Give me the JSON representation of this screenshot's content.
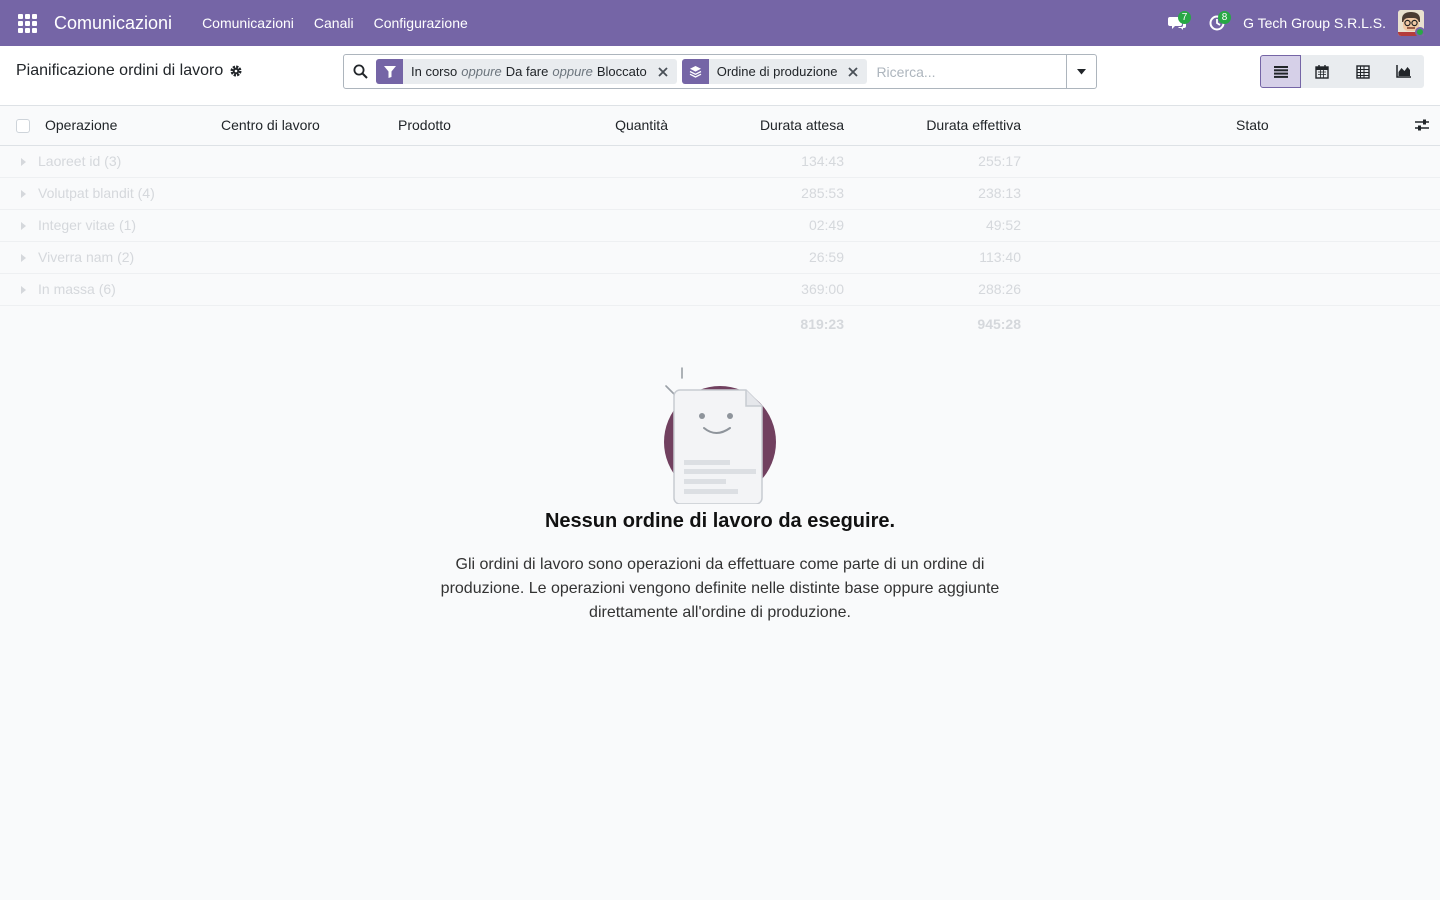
{
  "navbar": {
    "app_name": "Comunicazioni",
    "menu": [
      "Comunicazioni",
      "Canali",
      "Configurazione"
    ],
    "messages_count": "7",
    "activities_count": "8",
    "company": "G Tech Group S.R.L.S.",
    "accent": "#7565a6"
  },
  "control": {
    "title": "Pianificazione ordini di lavoro",
    "filter_facet": {
      "values": [
        "In corso",
        "Da fare",
        "Bloccato"
      ],
      "separator": "oppure"
    },
    "groupby_facet": {
      "value": "Ordine di produzione"
    },
    "search_placeholder": "Ricerca...",
    "views": [
      "list-icon",
      "calendar-icon",
      "pivot-icon",
      "graph-icon"
    ]
  },
  "list": {
    "columns": [
      "Operazione",
      "Centro di lavoro",
      "Prodotto",
      "Quantità",
      "Durata attesa",
      "Durata effettiva",
      "Stato"
    ],
    "groups": [
      {
        "name": "Laoreet id (3)",
        "expected": "134:43",
        "actual": "255:17"
      },
      {
        "name": "Volutpat blandit (4)",
        "expected": "285:53",
        "actual": "238:13"
      },
      {
        "name": "Integer vitae (1)",
        "expected": "02:49",
        "actual": "49:52"
      },
      {
        "name": "Viverra nam (2)",
        "expected": "26:59",
        "actual": "113:40"
      },
      {
        "name": "In massa (6)",
        "expected": "369:00",
        "actual": "288:26"
      }
    ],
    "totals": {
      "expected": "819:23",
      "actual": "945:28"
    }
  },
  "helper": {
    "title": "Nessun ordine di lavoro da eseguire.",
    "text": "Gli ordini di lavoro sono operazioni da effettuare come parte di un ordine di produzione. Le operazioni vengono definite nelle distinte base oppure aggiunte direttamente all'ordine di produzione."
  }
}
